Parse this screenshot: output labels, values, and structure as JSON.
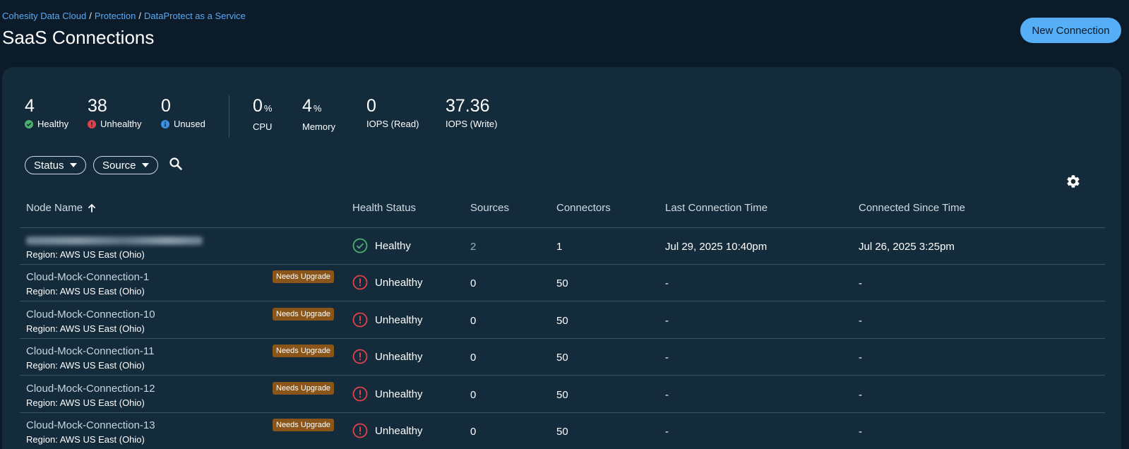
{
  "breadcrumb": {
    "items": [
      "Cohesity Data Cloud",
      "Protection",
      "DataProtect as a Service"
    ],
    "separator": "/"
  },
  "page_title": "SaaS Connections",
  "new_connection_label": "New Connection",
  "stats": {
    "healthy": {
      "value": "4",
      "label": "Healthy"
    },
    "unhealthy": {
      "value": "38",
      "label": "Unhealthy"
    },
    "unused": {
      "value": "0",
      "label": "Unused"
    },
    "cpu": {
      "value": "0",
      "unit": "%",
      "label": "CPU"
    },
    "memory": {
      "value": "4",
      "unit": "%",
      "label": "Memory"
    },
    "iops_read": {
      "value": "0",
      "label": "IOPS (Read)"
    },
    "iops_write": {
      "value": "37.36",
      "label": "IOPS (Write)"
    }
  },
  "filters": {
    "status": "Status",
    "source": "Source"
  },
  "table": {
    "headers": {
      "node_name": "Node Name",
      "health": "Health Status",
      "sources": "Sources",
      "connectors": "Connectors",
      "last_time": "Last Connection Time",
      "since_time": "Connected Since Time"
    },
    "rows": [
      {
        "name": "",
        "region": "Region: AWS US East (Ohio)",
        "badge": "",
        "health": "Healthy",
        "sources": "2",
        "connectors": "1",
        "last_time": "Jul 29, 2025 10:40pm",
        "since_time": "Jul 26, 2025 3:25pm"
      },
      {
        "name": "Cloud-Mock-Connection-1",
        "region": "Region: AWS US East (Ohio)",
        "badge": "Needs Upgrade",
        "health": "Unhealthy",
        "sources": "0",
        "connectors": "50",
        "last_time": "-",
        "since_time": "-"
      },
      {
        "name": "Cloud-Mock-Connection-10",
        "region": "Region: AWS US East (Ohio)",
        "badge": "Needs Upgrade",
        "health": "Unhealthy",
        "sources": "0",
        "connectors": "50",
        "last_time": "-",
        "since_time": "-"
      },
      {
        "name": "Cloud-Mock-Connection-11",
        "region": "Region: AWS US East (Ohio)",
        "badge": "Needs Upgrade",
        "health": "Unhealthy",
        "sources": "0",
        "connectors": "50",
        "last_time": "-",
        "since_time": "-"
      },
      {
        "name": "Cloud-Mock-Connection-12",
        "region": "Region: AWS US East (Ohio)",
        "badge": "Needs Upgrade",
        "health": "Unhealthy",
        "sources": "0",
        "connectors": "50",
        "last_time": "-",
        "since_time": "-"
      },
      {
        "name": "Cloud-Mock-Connection-13",
        "region": "Region: AWS US East (Ohio)",
        "badge": "Needs Upgrade",
        "health": "Unhealthy",
        "sources": "0",
        "connectors": "50",
        "last_time": "-",
        "since_time": "-"
      }
    ]
  },
  "colors": {
    "background": "#0c1b29",
    "panel": "#132b3b",
    "accent": "#56aef6",
    "link": "#5aaaf2",
    "healthy": "#4caf6e",
    "unhealthy": "#e0424a",
    "unused": "#3d8fe0",
    "badge": "#8a5518"
  },
  "icons": {
    "healthy": "check-circle-icon",
    "unhealthy": "exclamation-circle-icon",
    "unused": "info-circle-icon",
    "search": "search-icon",
    "settings": "gear-icon",
    "sort": "arrow-up-icon",
    "dropdown": "caret-down-icon"
  }
}
